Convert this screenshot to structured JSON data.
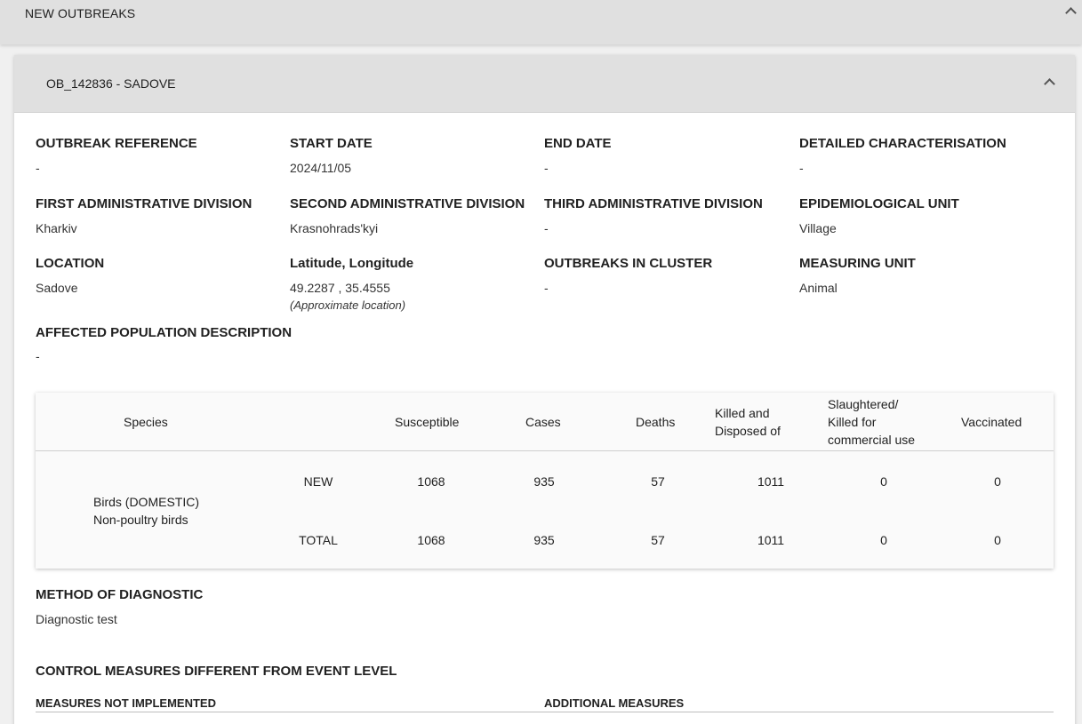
{
  "section": {
    "title": "NEW OUTBREAKS"
  },
  "outbreak": {
    "title": "OB_142836 - SADOVE",
    "fields": [
      {
        "label": "OUTBREAK REFERENCE",
        "value": "-"
      },
      {
        "label": "START DATE",
        "value": "2024/11/05"
      },
      {
        "label": "END DATE",
        "value": "-"
      },
      {
        "label": "DETAILED CHARACTERISATION",
        "value": "-"
      },
      {
        "label": "FIRST ADMINISTRATIVE DIVISION",
        "value": "Kharkiv"
      },
      {
        "label": "SECOND ADMINISTRATIVE DIVISION",
        "value": "Krasnohrads'kyi"
      },
      {
        "label": "THIRD ADMINISTRATIVE DIVISION",
        "value": "-"
      },
      {
        "label": "EPIDEMIOLOGICAL UNIT",
        "value": "Village"
      },
      {
        "label": "LOCATION",
        "value": "Sadove"
      },
      {
        "label": "Latitude, Longitude",
        "value": "49.2287 , 35.4555",
        "note": "(Approximate location)"
      },
      {
        "label": "OUTBREAKS IN CLUSTER",
        "value": "-"
      },
      {
        "label": "MEASURING UNIT",
        "value": "Animal"
      },
      {
        "label": "AFFECTED POPULATION DESCRIPTION",
        "value": "-"
      }
    ]
  },
  "table": {
    "headers": {
      "species": "Species",
      "susceptible": "Susceptible",
      "cases": "Cases",
      "deaths": "Deaths",
      "killed_1": "Killed and",
      "killed_2": "Disposed of",
      "slaughtered_1": "Slaughtered/",
      "slaughtered_2": "Killed for",
      "slaughtered_3": "commercial use",
      "vaccinated": "Vaccinated"
    },
    "species_line1": "Birds (DOMESTIC)",
    "species_line2": "Non-poultry birds",
    "rows": [
      {
        "type": "NEW",
        "susceptible": "1068",
        "cases": "935",
        "deaths": "57",
        "killed": "1011",
        "slaughtered": "0",
        "vaccinated": "0"
      },
      {
        "type": "TOTAL",
        "susceptible": "1068",
        "cases": "935",
        "deaths": "57",
        "killed": "1011",
        "slaughtered": "0",
        "vaccinated": "0"
      }
    ]
  },
  "diagnostic": {
    "label": "METHOD OF DIAGNOSTIC",
    "value": "Diagnostic test"
  },
  "control": {
    "title": "CONTROL MEASURES DIFFERENT FROM EVENT LEVEL",
    "not_implemented": "MEASURES NOT IMPLEMENTED",
    "additional": "ADDITIONAL MEASURES"
  },
  "icons": {
    "section_toggle": "chevron-up-icon",
    "outbreak_toggle": "chevron-up-icon"
  }
}
